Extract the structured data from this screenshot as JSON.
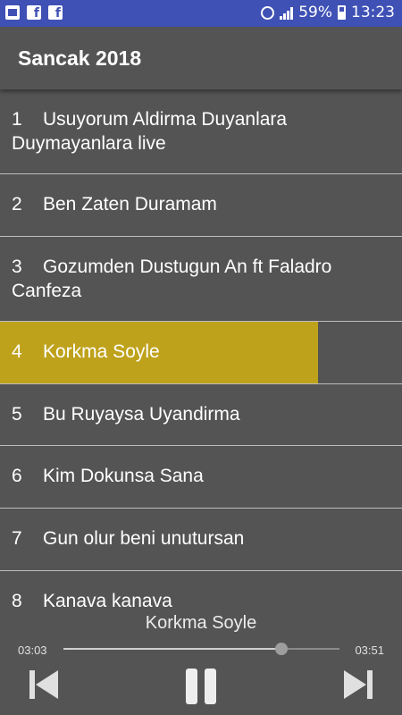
{
  "status_bar": {
    "battery_text": "59%",
    "time": "13:23",
    "battery_level": 0.59,
    "left_icons": [
      "image-icon",
      "facebook-icon",
      "facebook-icon"
    ]
  },
  "toolbar": {
    "title": "Sancak 2018"
  },
  "songs": [
    {
      "num": "1",
      "title": "Usuyorum Aldirma Duyanlara Duymayanlara live"
    },
    {
      "num": "2",
      "title": "Ben Zaten Duramam"
    },
    {
      "num": "3",
      "title": "Gozumden Dustugun An ft  Faladro Canfeza"
    },
    {
      "num": "4",
      "title": "Korkma Soyle"
    },
    {
      "num": "5",
      "title": "Bu Ruyaysa Uyandirma"
    },
    {
      "num": "6",
      "title": "Kim Dokunsa Sana"
    },
    {
      "num": "7",
      "title": "Gun olur beni unutursan"
    },
    {
      "num": "8",
      "title": "Kanava kanava"
    }
  ],
  "active_index": 3,
  "player": {
    "now_playing": "Korkma Soyle",
    "current_time": "03:03",
    "total_time": "03:51",
    "progress": 0.79
  },
  "colors": {
    "status_bar": "#3f51b5",
    "highlight": "#bfa21c",
    "background": "#545454"
  }
}
